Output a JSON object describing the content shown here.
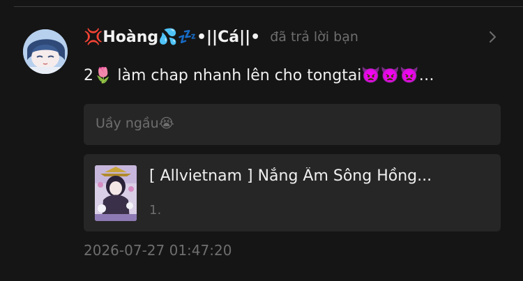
{
  "reply": {
    "username": "💢Hoàng💦💤•||Cá||•",
    "action": "đã trả lời bạn",
    "comment": "2🌷 làm chap nhanh lên cho tongtai👿👿👿…",
    "quoted": "Uầy ngầu😭",
    "story": {
      "title": "[ Allvietnam ] Nắng Ấm Sông Hồng...",
      "chapter": "1."
    },
    "timestamp": "2026-07-27 01:47:20"
  },
  "icons": {
    "chevron": "chevron-right-icon"
  },
  "colors": {
    "background": "#151515",
    "card": "#262626",
    "primary_text": "#f0f0f0",
    "secondary_text": "#6e6e6e"
  }
}
